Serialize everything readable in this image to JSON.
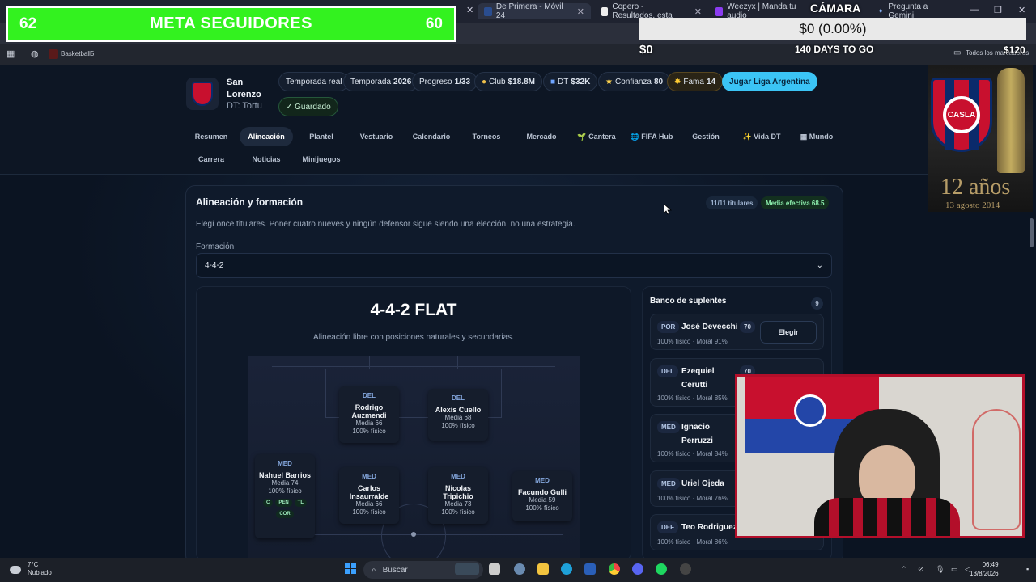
{
  "browser": {
    "tabs": [
      {
        "label": "De Primera - Móvil 24",
        "active": true
      },
      {
        "label": "Copero - Resultados, esta"
      },
      {
        "label": "Weezyx | Manda tu audio"
      },
      {
        "label": "Pregunta a Gemini"
      }
    ],
    "bookmark": "Basketball5",
    "bookmarks_right": "Todos los marcadores"
  },
  "overlay": {
    "meta_left": "62",
    "meta_title": "META SEGUIDORES",
    "meta_right": "60",
    "camera_label": "CÁMARA",
    "money_box": "$0 (0.00%)",
    "money_left": "$0",
    "days": "140 DAYS TO GO",
    "money_right": "$120",
    "club_years": "12 años",
    "club_date": "13 agosto 2014"
  },
  "club": {
    "name": "San Lorenzo",
    "dt": "DT: Tortu"
  },
  "stats": {
    "temporada_real": "Temporada real",
    "temporada_label": "Temporada",
    "temporada_value": "2026",
    "progreso_label": "Progreso",
    "progreso_value": "1/33",
    "club_label": "Club",
    "club_value": "$18.8M",
    "dt_label": "DT",
    "dt_value": "$32K",
    "confianza_label": "Confianza",
    "confianza_value": "80",
    "fama_label": "Fama",
    "fama_value": "14",
    "cta": "Jugar Liga Argentina",
    "saved": "✓ Guardado"
  },
  "nav": [
    "Resumen",
    "Alineación",
    "Plantel",
    "Vestuario",
    "Calendario",
    "Torneos",
    "Mercado",
    "🌱 Cantera",
    "🌐 FIFA Hub",
    "Gestión",
    "✨ Vida DT",
    "▦ Mundo",
    "Carrera",
    "Noticias",
    "Minijuegos"
  ],
  "lineup": {
    "title": "Alineación y formación",
    "badge_titulares": "11/11 titulares",
    "badge_media": "Media efectiva 68.5",
    "description": "Elegí once titulares. Poner cuatro nueves y ningún defensor sigue siendo una elección, no una estrategia.",
    "formation_label": "Formación",
    "formation_value": "4-4-2",
    "formation_title": "4-4-2 FLAT",
    "formation_sub": "Alineación libre con posiciones naturales y secundarias."
  },
  "players": [
    {
      "pos": "DEL",
      "name": "Rodrigo Auzmendi",
      "media": "Media 66",
      "fisico": "100% físico"
    },
    {
      "pos": "DEL",
      "name": "Alexis Cuello",
      "media": "Media 68",
      "fisico": "100% físico"
    },
    {
      "pos": "MED",
      "name": "Nahuel Barrios",
      "media": "Media 74",
      "fisico": "100% físico",
      "tags": [
        "C",
        "PEN",
        "TL",
        "COR"
      ]
    },
    {
      "pos": "MED",
      "name": "Carlos Insaurralde",
      "media": "Media 66",
      "fisico": "100% físico"
    },
    {
      "pos": "MED",
      "name": "Nicolas Tripichio",
      "media": "Media 73",
      "fisico": "100% físico"
    },
    {
      "pos": "MED",
      "name": "Facundo Gulli",
      "media": "Media 59",
      "fisico": "100% físico"
    }
  ],
  "bench": {
    "title": "Banco de suplentes",
    "count": "9",
    "elegir": "Elegir",
    "items": [
      {
        "pos": "POR",
        "name": "José Devecchi",
        "ovr": "70",
        "info": "100% físico · Moral 91%"
      },
      {
        "pos": "DEL",
        "name": "Ezequiel Cerutti",
        "ovr": "70",
        "info": "100% físico · Moral 85%"
      },
      {
        "pos": "MED",
        "name": "Ignacio Perruzzi",
        "ovr": "",
        "info": "100% físico · Moral 84%"
      },
      {
        "pos": "MED",
        "name": "Uriel Ojeda",
        "ovr": "",
        "info": "100% físico · Moral 76%"
      },
      {
        "pos": "DEF",
        "name": "Teo Rodriguez",
        "ovr": "",
        "info": "100% físico · Moral 86%"
      }
    ]
  },
  "taskbar": {
    "temp": "7°C",
    "weather": "Nublado",
    "search": "Buscar",
    "time": "06:49",
    "date": "13/8/2026"
  }
}
